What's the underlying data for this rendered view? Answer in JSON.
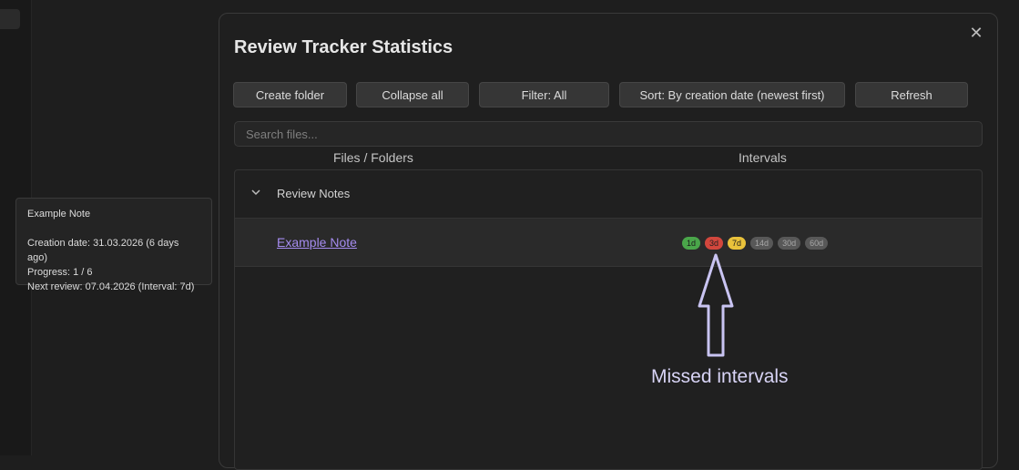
{
  "modal": {
    "title": "Review Tracker Statistics",
    "close_glyph": "✕"
  },
  "toolbar": {
    "create_folder": "Create folder",
    "collapse_all": "Collapse all",
    "filter": "Filter: All",
    "sort": "Sort: By creation date (newest first)",
    "refresh": "Refresh"
  },
  "search": {
    "placeholder": "Search files..."
  },
  "columns": {
    "files": "Files / Folders",
    "intervals": "Intervals"
  },
  "tree": {
    "folder": {
      "label": "Review Notes",
      "icon": "chevron-down-icon"
    },
    "file": {
      "label": "Example Note",
      "intervals": [
        {
          "label": "1d",
          "status": "done",
          "color": "#4aa64a"
        },
        {
          "label": "3d",
          "status": "missed",
          "color": "#d2473d"
        },
        {
          "label": "7d",
          "status": "current",
          "color": "#e9c23b"
        },
        {
          "label": "14d",
          "status": "pending",
          "color": "#585858"
        },
        {
          "label": "30d",
          "status": "pending",
          "color": "#585858"
        },
        {
          "label": "60d",
          "status": "pending",
          "color": "#585858"
        }
      ]
    }
  },
  "tooltip": {
    "title": "Example Note",
    "creation": "Creation date: 31.03.2026 (6 days ago)",
    "progress": "Progress: 1 / 6",
    "next_review": "Next review: 07.04.2026 (Interval: 7d)"
  },
  "annotation": {
    "text": "Missed intervals",
    "color": "#d8d4f6"
  }
}
